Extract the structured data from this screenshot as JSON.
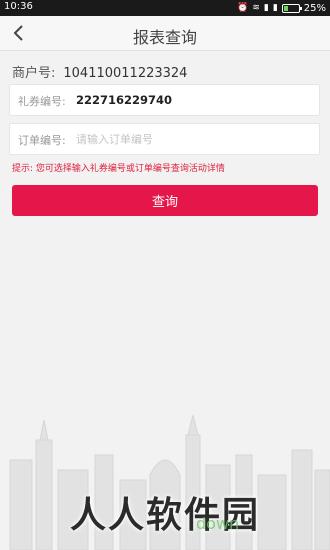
{
  "status_bar": {
    "time": "10:36",
    "battery_text": "25%",
    "battery_level": 0.25
  },
  "navbar": {
    "title": "报表查询",
    "back_icon": "chevron-left-icon"
  },
  "merchant": {
    "label": "商户号:",
    "value": "104110011223324"
  },
  "form": {
    "coupon_label": "礼券编号:",
    "coupon_value": "222716229740",
    "order_label": "订单编号:",
    "order_placeholder": "请输入订单编号"
  },
  "hint": "提示: 您可选择输入礼券编号或订单编号查询活动详情",
  "query_button": "查询",
  "watermark": "人人软件园",
  "watermark_sub": "down",
  "colors": {
    "accent": "#e5174a",
    "hint": "#e0203d"
  }
}
